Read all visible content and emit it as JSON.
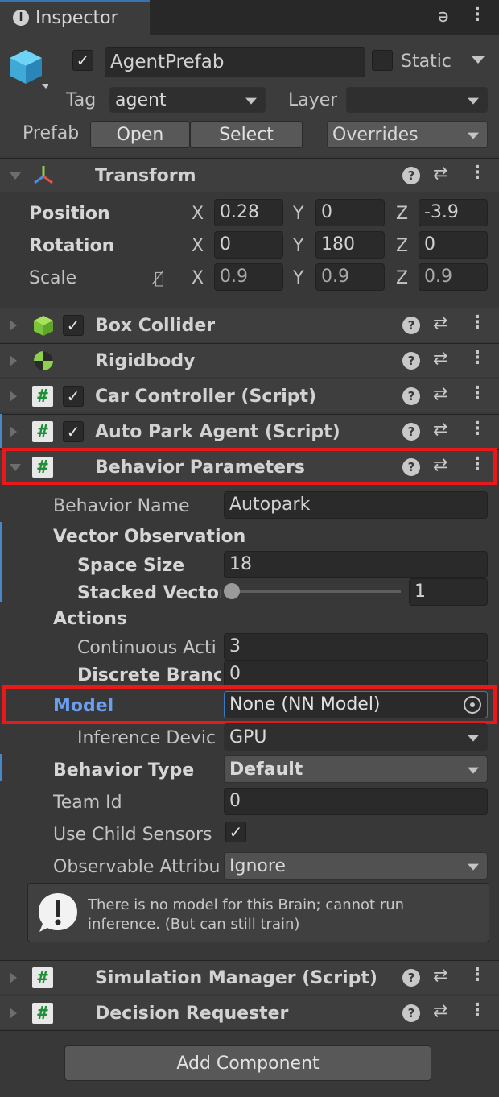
{
  "tab": {
    "label": "Inspector",
    "lock_icon": "lock-icon",
    "menu_icon": "kebab-menu-icon"
  },
  "object": {
    "name": "AgentPrefab",
    "active": true,
    "static_label": "Static",
    "tag_label": "Tag",
    "tag_value": "agent",
    "layer_label": "Layer",
    "layer_value": "",
    "prefab_label": "Prefab",
    "open_label": "Open",
    "select_label": "Select",
    "overrides_label": "Overrides"
  },
  "transform": {
    "title": "Transform",
    "position_label": "Position",
    "rotation_label": "Rotation",
    "scale_label": "Scale",
    "x": "X",
    "y": "Y",
    "z": "Z",
    "position": {
      "x": "0.28",
      "y": "0",
      "z": "-3.9"
    },
    "rotation": {
      "x": "0",
      "y": "180",
      "z": "0"
    },
    "scale": {
      "x": "0.9",
      "y": "0.9",
      "z": "0.9"
    }
  },
  "components": {
    "box_collider": "Box Collider",
    "rigidbody": "Rigidbody",
    "car_controller": "Car Controller (Script)",
    "auto_park_agent": "Auto Park Agent (Script)",
    "behavior_parameters": "Behavior Parameters",
    "simulation_manager": "Simulation Manager (Script)",
    "decision_requester": "Decision Requester"
  },
  "behavior": {
    "behavior_name_label": "Behavior Name",
    "behavior_name_value": "Autopark",
    "vector_observation_label": "Vector Observation",
    "space_size_label": "Space Size",
    "space_size_value": "18",
    "stacked_vectors_label": "Stacked Vectoı",
    "stacked_vectors_value": "1",
    "stacked_vectors_slider": 0,
    "actions_label": "Actions",
    "continuous_label": "Continuous Acti",
    "continuous_value": "3",
    "discrete_label": "Discrete Brancl",
    "discrete_value": "0",
    "model_label": "Model",
    "model_value": "None (NN Model)",
    "inference_label": "Inference Devic",
    "inference_value": "GPU",
    "behavior_type_label": "Behavior Type",
    "behavior_type_value": "Default",
    "team_id_label": "Team Id",
    "team_id_value": "0",
    "use_child_sensors_label": "Use Child Sensors",
    "use_child_sensors": true,
    "observable_label": "Observable Attribu",
    "observable_value": "Ignore",
    "help_text_line1": "There is no model for this Brain; cannot run",
    "help_text_line2": "inference. (But can still train)"
  },
  "footer": {
    "add_component_label": "Add Component"
  },
  "colors": {
    "highlight": "#e8181b",
    "model_label": "#6a9ef0",
    "accent_bar": "#4a86c8"
  }
}
